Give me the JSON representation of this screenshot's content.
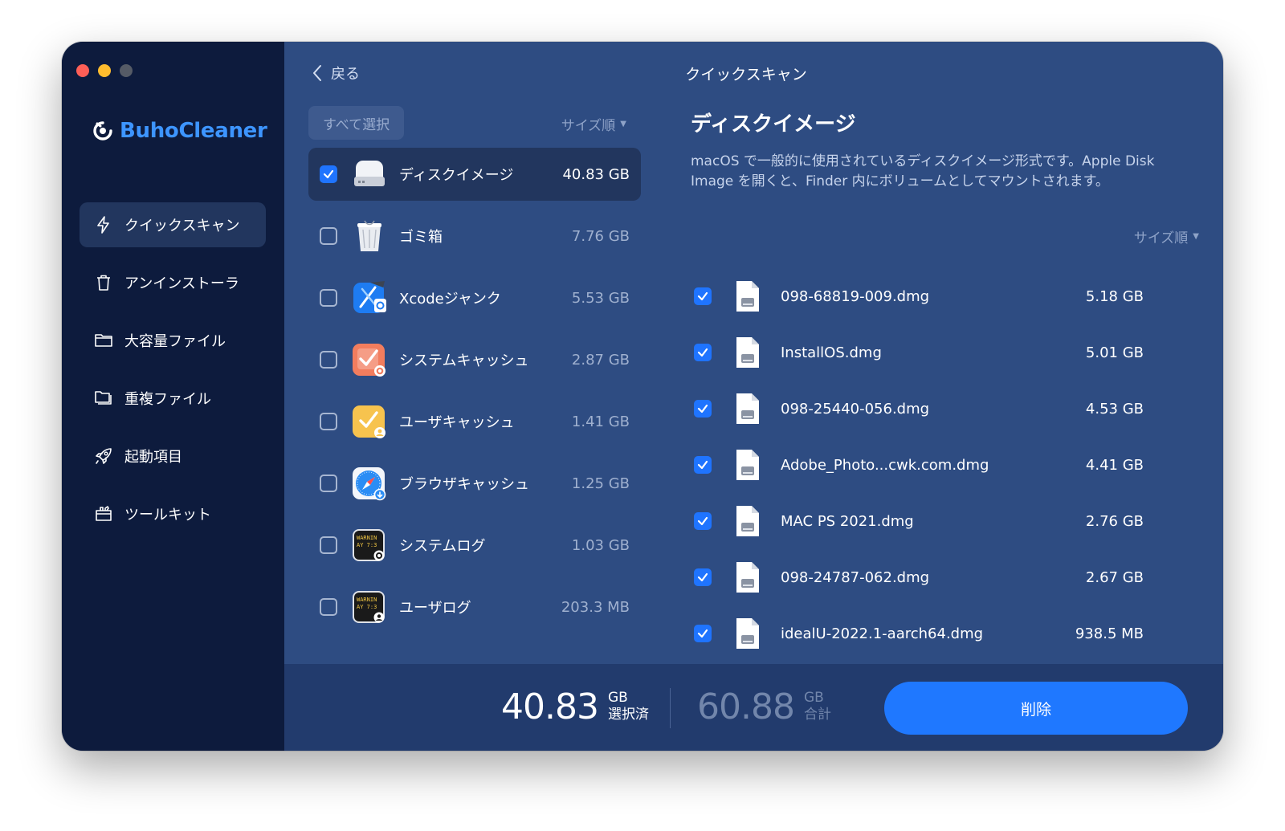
{
  "app": {
    "name": "BuhoCleaner"
  },
  "sidebar": {
    "items": [
      {
        "label": "クイックスキャン",
        "icon": "bolt-icon",
        "active": true
      },
      {
        "label": "アンインストーラ",
        "icon": "trash-icon",
        "active": false
      },
      {
        "label": "大容量ファイル",
        "icon": "folder-icon",
        "active": false
      },
      {
        "label": "重複ファイル",
        "icon": "duplicate-folder-icon",
        "active": false
      },
      {
        "label": "起動項目",
        "icon": "rocket-icon",
        "active": false
      },
      {
        "label": "ツールキット",
        "icon": "toolkit-icon",
        "active": false
      }
    ]
  },
  "topbar": {
    "back_label": "戻る",
    "title": "クイックスキャン"
  },
  "list": {
    "select_all_label": "すべて選択",
    "sort_label": "サイズ順",
    "categories": [
      {
        "name": "ディスクイメージ",
        "size": "40.83 GB",
        "checked": true,
        "icon": "disk-image-icon"
      },
      {
        "name": "ゴミ箱",
        "size": "7.76 GB",
        "checked": false,
        "icon": "trash-bin-icon"
      },
      {
        "name": "Xcodeジャンク",
        "size": "5.53 GB",
        "checked": false,
        "icon": "xcode-icon"
      },
      {
        "name": "システムキャッシュ",
        "size": "2.87 GB",
        "checked": false,
        "icon": "system-cache-icon"
      },
      {
        "name": "ユーザキャッシュ",
        "size": "1.41 GB",
        "checked": false,
        "icon": "user-cache-icon"
      },
      {
        "name": "ブラウザキャッシュ",
        "size": "1.25 GB",
        "checked": false,
        "icon": "browser-cache-icon"
      },
      {
        "name": "システムログ",
        "size": "1.03 GB",
        "checked": false,
        "icon": "system-log-icon"
      },
      {
        "name": "ユーザログ",
        "size": "203.3 MB",
        "checked": false,
        "icon": "user-log-icon"
      }
    ]
  },
  "detail": {
    "title": "ディスクイメージ",
    "description": "macOS で一般的に使用されているディスクイメージ形式です。Apple Disk Image を開くと、Finder 内にボリュームとしてマウントされます。",
    "sort_label": "サイズ順",
    "files": [
      {
        "name": "098-68819-009.dmg",
        "size": "5.18 GB",
        "checked": true
      },
      {
        "name": "InstallOS.dmg",
        "size": "5.01 GB",
        "checked": true
      },
      {
        "name": "098-25440-056.dmg",
        "size": "4.53 GB",
        "checked": true
      },
      {
        "name": "Adobe_Photo...cwk.com.dmg",
        "size": "4.41 GB",
        "checked": true
      },
      {
        "name": "MAC PS 2021.dmg",
        "size": "2.76 GB",
        "checked": true
      },
      {
        "name": "098-24787-062.dmg",
        "size": "2.67 GB",
        "checked": true
      },
      {
        "name": "idealU-2022.1-aarch64.dmg",
        "size": "938.5 MB",
        "checked": true
      }
    ]
  },
  "footer": {
    "selected_value": "40.83",
    "selected_unit": "GB",
    "selected_label": "選択済",
    "total_value": "60.88",
    "total_unit": "GB",
    "total_label": "合計",
    "delete_label": "削除"
  },
  "colors": {
    "sidebar_bg": "#0d1b3d",
    "content_bg": "#2e4c82",
    "accent": "#1f78ff",
    "brand": "#3d95ff"
  }
}
